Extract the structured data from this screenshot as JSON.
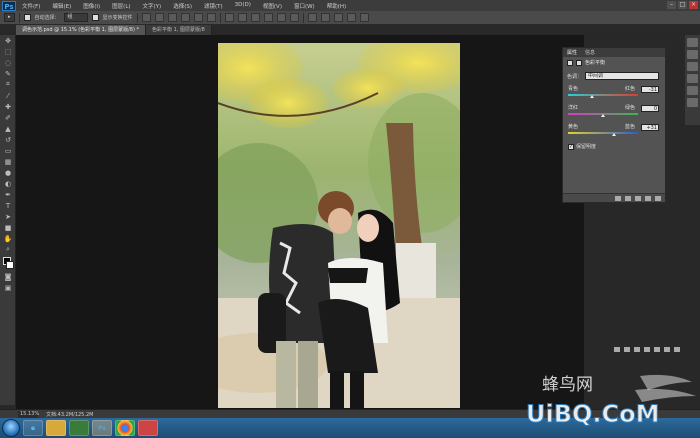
{
  "app": {
    "logo": "Ps"
  },
  "menu": [
    "文件(F)",
    "编辑(E)",
    "图像(I)",
    "图层(L)",
    "文字(Y)",
    "选择(S)",
    "滤镜(T)",
    "3D(D)",
    "视图(V)",
    "窗口(W)",
    "帮助(H)"
  ],
  "window_controls": {
    "minimize": "–",
    "maximize": "□",
    "close": "×"
  },
  "options": {
    "tool_glyph": "▸",
    "auto_select_label": "自动选择：",
    "auto_select_value": "组",
    "show_transform_label": "显示变换控件"
  },
  "tabs": [
    {
      "label": "调色示范.psd @ 15.1% (色彩平衡 1, 图层蒙版/8) *",
      "active": true
    },
    {
      "label": "色彩平衡 1, 图层蒙版/8",
      "active": false
    }
  ],
  "properties": {
    "tab_properties": "属性",
    "tab_info": "信息",
    "title": "色彩平衡",
    "tone_label": "色调：",
    "tone_value": "中间调",
    "sliders": [
      {
        "left": "青色",
        "right": "红色",
        "value": "-31",
        "level": -31,
        "gradient": [
          "#25d0d6",
          "#e23a2a"
        ]
      },
      {
        "left": "洋红",
        "right": "绿色",
        "value": "0",
        "level": 0,
        "gradient": [
          "#d43cc4",
          "#3ab84a"
        ]
      },
      {
        "left": "黄色",
        "right": "蓝色",
        "value": "+31",
        "level": 31,
        "gradient": [
          "#e2d12a",
          "#2a5ed4"
        ]
      }
    ],
    "preserve_label": "保留明度",
    "preserve_checked": "✓"
  },
  "status": {
    "zoom": "15.13%",
    "doc": "文档:43.2M/125.2M"
  },
  "taskbar": {
    "ps_label": "Ps"
  },
  "watermark": {
    "cn": "蜂鸟网",
    "en": "UiBQ.CoM"
  }
}
